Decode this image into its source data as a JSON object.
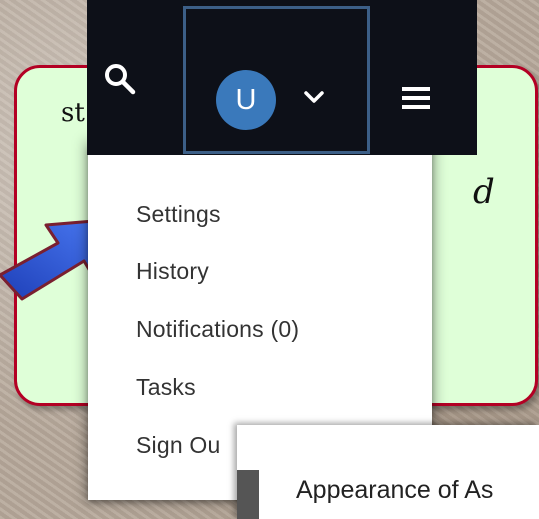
{
  "callout": {
    "left_text": "st",
    "right_text": "d"
  },
  "menu": {
    "items": [
      {
        "label": "Settings"
      },
      {
        "label": "History"
      },
      {
        "label": "Notifications (0)"
      },
      {
        "label": "Tasks"
      },
      {
        "label": "Sign Ou"
      }
    ]
  },
  "user": {
    "avatar_initial": "U"
  },
  "icons": {
    "search": "search-icon",
    "chevron": "chevron-down-icon",
    "menu": "hamburger-menu-icon",
    "arrow": "pointer-arrow-icon"
  },
  "colors": {
    "navbar": "#0d1018",
    "avatar": "#3a79bb",
    "callout_border": "#b30024",
    "callout_fill": "#dfffd8",
    "arrow": "#2f5fe0"
  },
  "secondary": {
    "text": "Appearance of As"
  }
}
